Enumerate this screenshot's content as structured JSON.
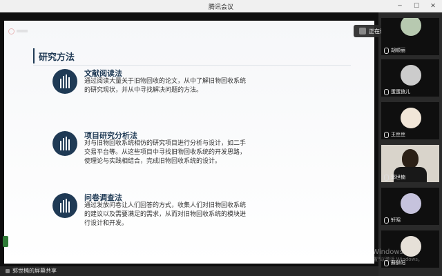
{
  "window": {
    "title": "腾讯会议"
  },
  "slide": {
    "header": "研究方法",
    "sections": [
      {
        "title": "文献阅读法",
        "text": "通过阅读大量关于旧物回收的论文，从中了解旧物回收系统的研究现状，并从中寻找解决问题的方法。"
      },
      {
        "title": "项目研究分析法",
        "text": "对与旧物回收系统相仿的研究项目进行分析与设计，如二手交易平台等。从这些项目中寻找旧物回收系统的开发思路，使理论与实践相结合，完成旧物回收系统的设计。"
      },
      {
        "title": "问卷调查法",
        "text": "通过发放问卷让人们回答的方式，收集人们对旧物回收系统的建议以及需要满足的需求，从而对旧物回收系统的模块进行设计和开发。"
      }
    ]
  },
  "speaking": {
    "label": "正在讲话：郭世楠"
  },
  "participants": [
    {
      "name": "胡顺丽"
    },
    {
      "name": "蛋蛋狼儿"
    },
    {
      "name": "王丝丝"
    },
    {
      "name": "郭世楠"
    },
    {
      "name": "轩昭"
    },
    {
      "name": "蘇醉阳"
    }
  ],
  "share_bar": {
    "label": "郭世楠的屏幕共享"
  },
  "watermark": {
    "line1": "激活 Windows",
    "line2": "转到\"设置\"以激活 Windows。"
  },
  "colors": {
    "accent": "#1f3a55",
    "sidebar": "#2a2a2a"
  }
}
